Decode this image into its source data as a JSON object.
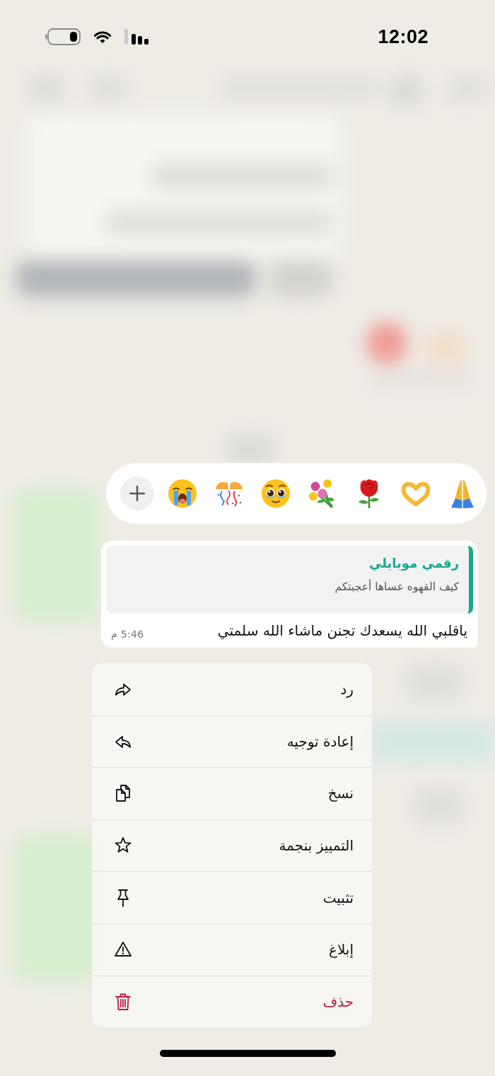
{
  "status_bar": {
    "time": "12:02"
  },
  "reactions": [
    {
      "kind": "add"
    },
    {
      "kind": "crying"
    },
    {
      "kind": "confetti"
    },
    {
      "kind": "pleading"
    },
    {
      "kind": "bouquet"
    },
    {
      "kind": "rose"
    },
    {
      "kind": "hearthands"
    },
    {
      "kind": "praying"
    }
  ],
  "message": {
    "quote": {
      "sender": "رقمي موبايلي",
      "text": "كيف القهوه عساها أعجبتكم"
    },
    "text": "ياقلبي الله يسعدك تجنن ماشاء الله سلمتي",
    "time": "5:46 م"
  },
  "menu": [
    {
      "kind": "reply",
      "label": "رد",
      "destructive": false
    },
    {
      "kind": "forward",
      "label": "إعادة توجيه",
      "destructive": false
    },
    {
      "kind": "copy",
      "label": "نسخ",
      "destructive": false
    },
    {
      "kind": "star",
      "label": "التمييز بنجمة",
      "destructive": false
    },
    {
      "kind": "pin",
      "label": "تثبيت",
      "destructive": false
    },
    {
      "kind": "report",
      "label": "إبلاغ",
      "destructive": false
    },
    {
      "kind": "delete",
      "label": "حذف",
      "destructive": true
    }
  ]
}
